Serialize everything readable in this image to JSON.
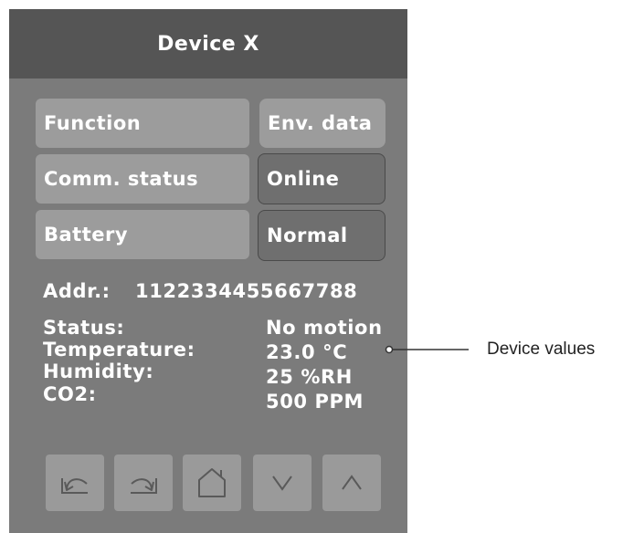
{
  "header": {
    "title": "Device X"
  },
  "rows": [
    {
      "label": "Function",
      "value": "Env. data"
    },
    {
      "label": "Comm. status",
      "value": "Online"
    },
    {
      "label": "Battery",
      "value": "Normal"
    }
  ],
  "address": {
    "label": "Addr.:",
    "value": "1122334455667788"
  },
  "readings": [
    {
      "label": "Status:",
      "value": "No motion"
    },
    {
      "label": "Temperature:",
      "value": "23.0 °C"
    },
    {
      "label": "Humidity:",
      "value": "25 %RH"
    },
    {
      "label": "CO2:",
      "value": "500 PPM"
    }
  ],
  "nav": [
    {
      "icon": "undo-icon"
    },
    {
      "icon": "redo-icon"
    },
    {
      "icon": "home-icon"
    },
    {
      "icon": "chevron-down-icon"
    },
    {
      "icon": "chevron-up-icon"
    }
  ],
  "callout": {
    "label": "Device values"
  },
  "colors": {
    "panel": "#7b7b7b",
    "header": "#555555",
    "button": "#9c9c9c",
    "text": "#ffffff"
  }
}
